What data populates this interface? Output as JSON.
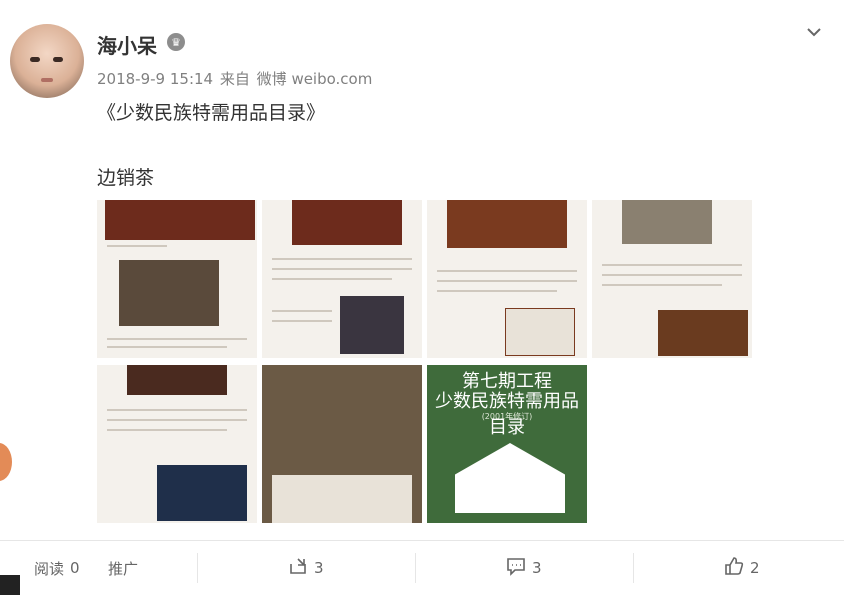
{
  "post": {
    "username": "海小呆",
    "date": "2018-9-9 15:14",
    "from_label": "来自",
    "source": "微博 weibo.com",
    "text_line1": "《少数民族特需用品目录》",
    "text_line2": "边销茶"
  },
  "cover_image": {
    "title1": "第七期工程",
    "title2": "少数民族特需用品目录",
    "subtitle": "(2001年修订)"
  },
  "footer": {
    "read_label": "阅读",
    "read_count": "0",
    "promote_label": "推广",
    "share_count": "3",
    "comment_count": "3",
    "like_count": "2"
  },
  "colors": {
    "accent": "#f5a623",
    "text": "#333333",
    "meta": "#808080"
  }
}
